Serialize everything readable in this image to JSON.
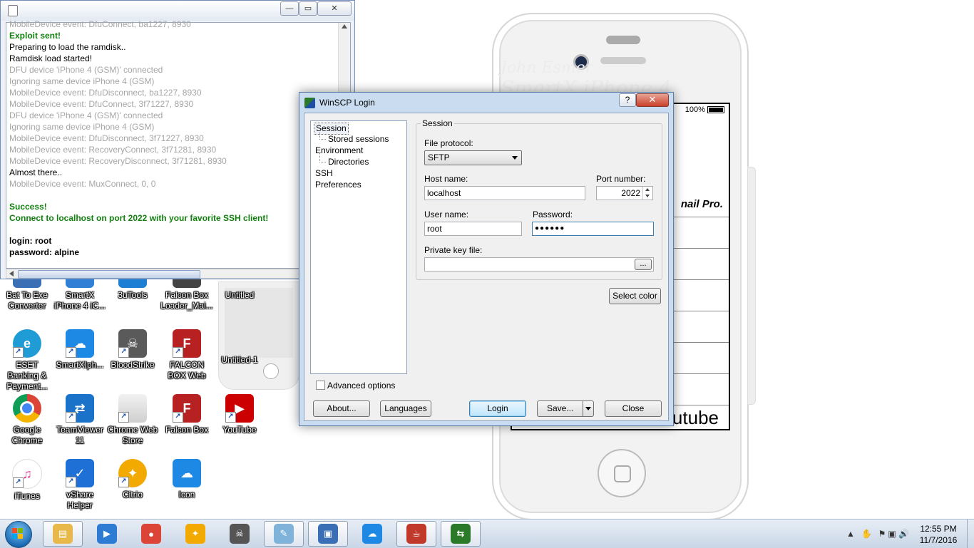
{
  "desktop_icons": [
    {
      "id": "bat-to-exe",
      "label": "Bat To Exe Converter",
      "color": "#3a6fb5",
      "glyph": ""
    },
    {
      "id": "smartx-iphone",
      "label": "SmartX iPhone 4 iC...",
      "color": "#2f7fd6",
      "glyph": ""
    },
    {
      "id": "3utools",
      "label": "3uTools",
      "color": "#1d7fd3",
      "glyph": ""
    },
    {
      "id": "falcon-box-loader",
      "label": "Falcon Box Loader_Mai...",
      "color": "#444444",
      "glyph": ""
    },
    {
      "id": "untitled",
      "label": "Untitled",
      "color": "#999999",
      "glyph": ""
    },
    {
      "id": "eset",
      "label": "ESET Banking & Payment...",
      "color": "#1f9bd6",
      "glyph": "e"
    },
    {
      "id": "smartxiphone2",
      "label": "SmartXIph...",
      "color": "#1e88e5",
      "glyph": "☁"
    },
    {
      "id": "bloodstrike",
      "label": "BloodStrike",
      "color": "#5a5a5a",
      "glyph": "☠"
    },
    {
      "id": "falcon-box-web",
      "label": "FALCON BOX Web",
      "color": "#b72121",
      "glyph": "F"
    },
    {
      "id": "untitled-1",
      "label": "Untitled-1",
      "color": "#999999",
      "glyph": ""
    },
    {
      "id": "google-chrome",
      "label": "Google Chrome",
      "color": "#db4437",
      "glyph": "●"
    },
    {
      "id": "teamviewer",
      "label": "TeamViewer 11",
      "color": "#1a73c9",
      "glyph": "⇄"
    },
    {
      "id": "chrome-web-store",
      "label": "Chrome Web Store",
      "color": "#e6e6e6",
      "glyph": ""
    },
    {
      "id": "falcon-box",
      "label": "Falcon Box",
      "color": "#b72121",
      "glyph": "F"
    },
    {
      "id": "youtube",
      "label": "YouTube",
      "color": "#cc0000",
      "glyph": "▶"
    },
    {
      "id": "itunes",
      "label": "iTunes",
      "color": "#e53a8a",
      "glyph": "♫"
    },
    {
      "id": "vshare",
      "label": "vShare Helper",
      "color": "#1e6fd6",
      "glyph": "✓"
    },
    {
      "id": "citrio",
      "label": "Citrio",
      "color": "#f2a900",
      "glyph": "✦"
    },
    {
      "id": "icon",
      "label": "Icon",
      "color": "#1e88e5",
      "glyph": "☁"
    }
  ],
  "log_window": {
    "lines": [
      {
        "t": "MobileDevice event: DfuConnect, ba1227, 8930",
        "s": "g"
      },
      {
        "t": "Exploit sent!",
        "s": "green"
      },
      {
        "t": "Preparing to load the ramdisk..",
        "s": "b"
      },
      {
        "t": "Ramdisk load started!",
        "s": "b"
      },
      {
        "t": "DFU device 'iPhone 4 (GSM)' connected",
        "s": "g"
      },
      {
        "t": "Ignoring same device iPhone 4 (GSM)",
        "s": "g"
      },
      {
        "t": "MobileDevice event: DfuDisconnect, ba1227, 8930",
        "s": "g"
      },
      {
        "t": "MobileDevice event: DfuConnect, 3f71227, 8930",
        "s": "g"
      },
      {
        "t": "DFU device 'iPhone 4 (GSM)' connected",
        "s": "g"
      },
      {
        "t": "Ignoring same device iPhone 4 (GSM)",
        "s": "g"
      },
      {
        "t": "MobileDevice event: DfuDisconnect, 3f71227, 8930",
        "s": "g"
      },
      {
        "t": "MobileDevice event: RecoveryConnect, 3f71281, 8930",
        "s": "g"
      },
      {
        "t": "MobileDevice event: RecoveryDisconnect, 3f71281, 8930",
        "s": "g"
      },
      {
        "t": "Almost there..",
        "s": "b"
      },
      {
        "t": "MobileDevice event: MuxConnect, 0, 0",
        "s": "g"
      },
      {
        "t": "",
        "s": "b"
      },
      {
        "t": "Success!",
        "s": "green"
      },
      {
        "t": "Connect to localhost on port 2022 with your favorite SSH client!",
        "s": "green"
      },
      {
        "t": "",
        "s": "b"
      },
      {
        "t": "login: root",
        "s": "bold"
      },
      {
        "t": "password: alpine",
        "s": "bold"
      }
    ]
  },
  "phone": {
    "watermark_line1": "John Esmer",
    "watermark_line2": "SmartX iPhone 4",
    "battery": "100%",
    "partial_text": "nail Pro.",
    "bottom_text": "utube"
  },
  "winscp": {
    "title": "WinSCP Login",
    "help": "?",
    "tree": [
      {
        "label": "Session",
        "level": 0,
        "selected": true
      },
      {
        "label": "Stored sessions",
        "level": 1,
        "selected": false
      },
      {
        "label": "Environment",
        "level": 0,
        "selected": false
      },
      {
        "label": "Directories",
        "level": 1,
        "selected": false
      },
      {
        "label": "SSH",
        "level": 0,
        "selected": false
      },
      {
        "label": "Preferences",
        "level": 0,
        "selected": false
      }
    ],
    "session_group": "Session",
    "file_protocol_label": "File protocol:",
    "file_protocol_value": "SFTP",
    "host_name_label": "Host name:",
    "host_name_value": "localhost",
    "port_label": "Port number:",
    "port_value": "2022",
    "user_label": "User name:",
    "user_value": "root",
    "password_label": "Password:",
    "password_value": "●●●●●●",
    "private_key_label": "Private key file:",
    "private_key_value": "",
    "browse": "...",
    "select_color": "Select color",
    "advanced_options": "Advanced options",
    "about": "About...",
    "languages": "Languages",
    "login": "Login",
    "save": "Save...",
    "close": "Close"
  },
  "taskbar": {
    "apps": [
      {
        "id": "explorer",
        "color": "#e8b84a",
        "glyph": "▤",
        "active": true
      },
      {
        "id": "media-player",
        "color": "#2d7bd3",
        "glyph": "▶",
        "active": false
      },
      {
        "id": "chrome",
        "color": "#db4437",
        "glyph": "●",
        "active": false
      },
      {
        "id": "citrio",
        "color": "#f2a900",
        "glyph": "✦",
        "active": false
      },
      {
        "id": "bloodstrike",
        "color": "#555555",
        "glyph": "☠",
        "active": false
      },
      {
        "id": "notepad",
        "color": "#7fb3d9",
        "glyph": "✎",
        "active": true
      },
      {
        "id": "smartx",
        "color": "#3a6fb5",
        "glyph": "▣",
        "active": true
      },
      {
        "id": "icloud",
        "color": "#1e88e5",
        "glyph": "☁",
        "active": false
      },
      {
        "id": "java",
        "color": "#c0392b",
        "glyph": "☕",
        "active": true
      },
      {
        "id": "winscp",
        "color": "#2a7a2a",
        "glyph": "⇆",
        "active": true
      }
    ],
    "time": "12:55 PM",
    "date": "11/7/2016"
  }
}
